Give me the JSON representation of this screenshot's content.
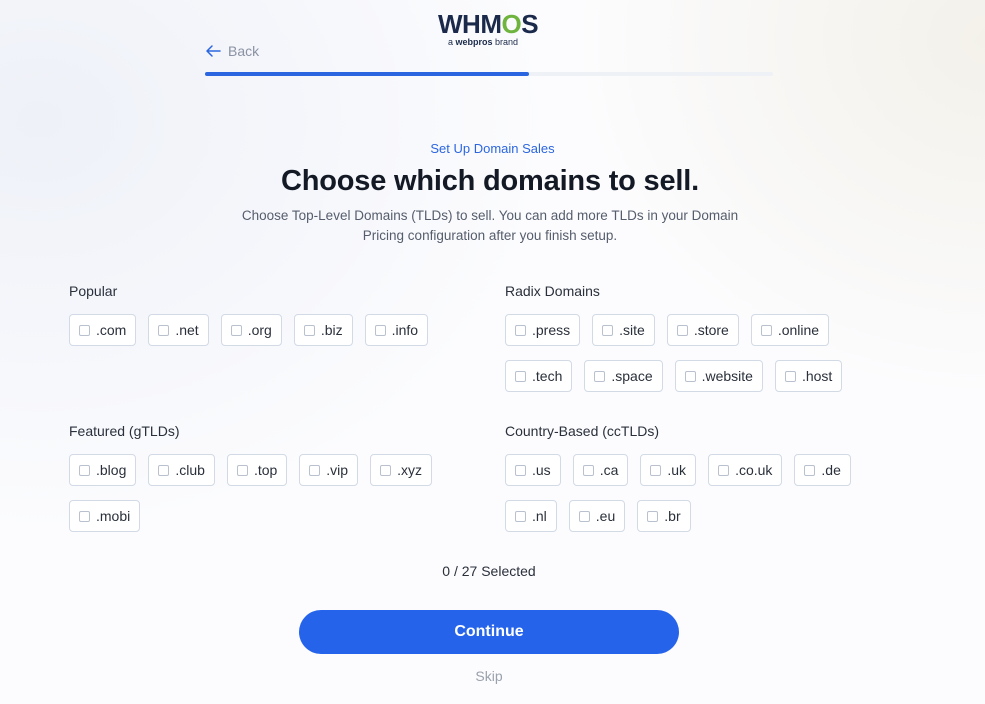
{
  "logo": {
    "word_pre": "WHM",
    "word_gear": "O",
    "word_post": "S",
    "sub_pre": "a ",
    "sub_brand": "webpros",
    "sub_post": " brand"
  },
  "nav": {
    "back_label": "Back",
    "progress": 0.57
  },
  "header": {
    "eyebrow": "Set Up Domain Sales",
    "title": "Choose which domains to sell.",
    "description": "Choose Top-Level Domains (TLDs) to sell. You can add more TLDs in your Domain Pricing configuration after you finish setup."
  },
  "groups": {
    "popular": {
      "label": "Popular",
      "tlds": [
        ".com",
        ".net",
        ".org",
        ".biz",
        ".info"
      ]
    },
    "radix": {
      "label": "Radix Domains",
      "tlds": [
        ".press",
        ".site",
        ".store",
        ".online",
        ".tech",
        ".space",
        ".website",
        ".host"
      ]
    },
    "featured": {
      "label": "Featured (gTLDs)",
      "tlds": [
        ".blog",
        ".club",
        ".top",
        ".vip",
        ".xyz",
        ".mobi"
      ]
    },
    "country": {
      "label": "Country-Based (ccTLDs)",
      "tlds": [
        ".us",
        ".ca",
        ".uk",
        ".co.uk",
        ".de",
        ".nl",
        ".eu",
        ".br"
      ]
    }
  },
  "selection": {
    "count_text": "0 / 27 Selected"
  },
  "actions": {
    "continue_label": "Continue",
    "skip_label": "Skip"
  },
  "colors": {
    "accent": "#2563eb",
    "progress": "#2b66e0",
    "border": "#d2dae6"
  }
}
